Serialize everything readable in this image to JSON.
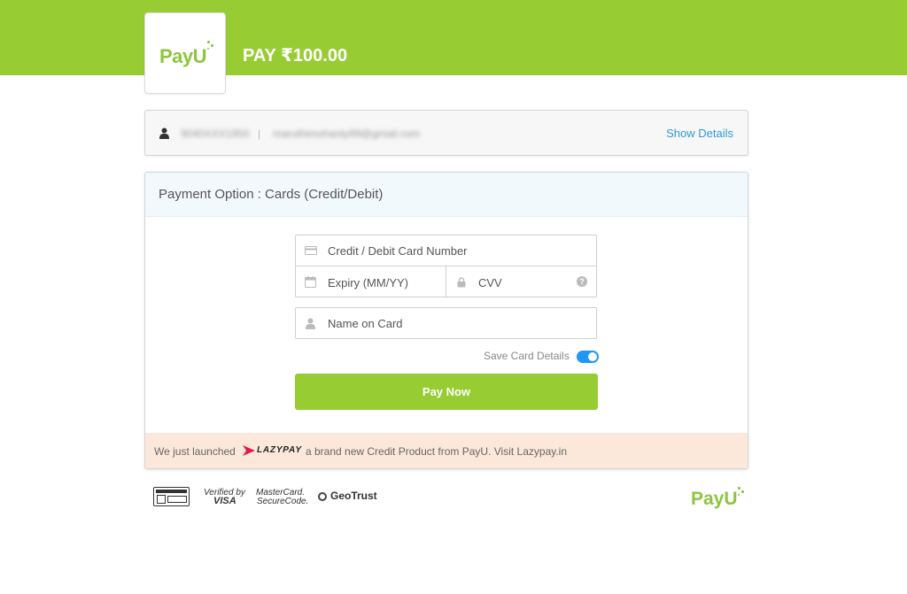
{
  "header": {
    "brand": {
      "pay": "Pay",
      "u": "U"
    },
    "amount_title": "PAY ₹100.00"
  },
  "customer": {
    "phone": "9040XXX1950",
    "email": "maruthimohanty99@gmail.com",
    "separator": "|",
    "show_details": "Show Details"
  },
  "payment": {
    "title": "Payment Option : Cards (Credit/Debit)",
    "fields": {
      "card_number": "Credit / Debit Card Number",
      "expiry": "Expiry (MM/YY)",
      "cvv": "CVV",
      "name": "Name on Card"
    },
    "save_card_label": "Save Card Details",
    "save_card_enabled": true,
    "pay_button": "Pay Now",
    "promo": {
      "before": "We just launched",
      "brand": "LAZYPAY",
      "after": "a brand new Credit Product from PayU. Visit Lazypay.in"
    }
  },
  "footer": {
    "badges": {
      "visa_line1": "Verified by",
      "visa_line2": "VISA",
      "mc_line1": "MasterCard.",
      "mc_line2": "SecureCode.",
      "geotrust": "GeoTrust"
    },
    "brand": {
      "pay": "Pay",
      "u": "U"
    }
  },
  "colors": {
    "brand_green": "#97cc33",
    "link_blue": "#2d9bd6",
    "toggle_blue": "#2196f3",
    "promo_bg": "#fbe8da"
  },
  "icons": [
    "user-icon",
    "card-icon",
    "calendar-icon",
    "lock-icon",
    "help-icon",
    "person-icon",
    "lazypay-icon"
  ]
}
